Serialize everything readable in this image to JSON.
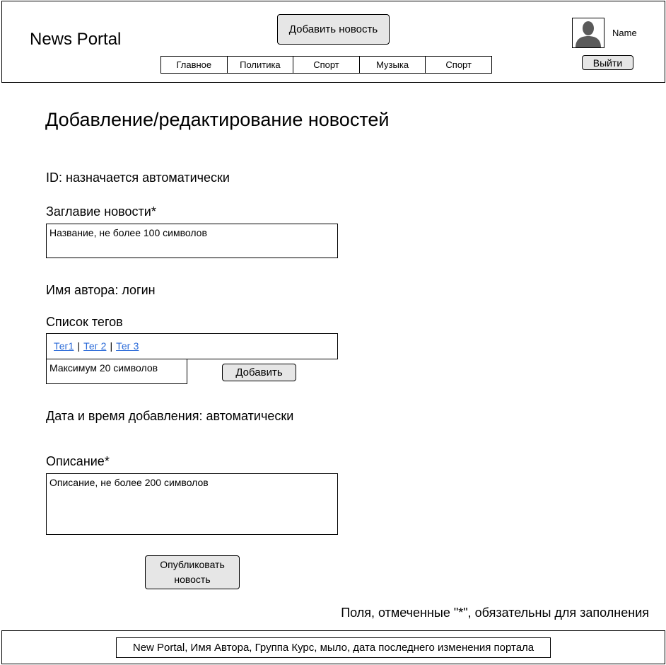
{
  "header": {
    "logo": "News Portal",
    "add_news_label": "Добавить новость",
    "nav": [
      "Главное",
      "Политика",
      "Спорт",
      "Музыка",
      "Спорт"
    ],
    "user_name": "Name",
    "logout_label": "Выйти",
    "avatar_icon": "user-avatar-icon"
  },
  "form": {
    "page_title": "Добавление/редактирование новостей",
    "id_label": "ID: назначается автоматически",
    "title_label": "Заглавие новости*",
    "title_placeholder": "Название, не более 100 символов",
    "author_label": "Имя автора: логин",
    "tags_label": "Список тегов",
    "tags": [
      "Тег1",
      "Тег 2",
      "Тег 3"
    ],
    "tag_separator": "|",
    "tag_placeholder": "Максимум 20 символов",
    "tag_add_label": "Добавить",
    "date_label": "Дата и время добавления: автоматически",
    "description_label": "Описание*",
    "description_placeholder": "Описание, не более 200 символов",
    "publish_line1": "Опубликовать",
    "publish_line2": "новость",
    "required_note": "Поля, отмеченные \"*\", обязательны для заполнения"
  },
  "footer": {
    "text": "New Portal, Имя Автора, Группа Курс, мыло, дата последнего изменения портала"
  },
  "colors": {
    "button_bg": "#e6e6e6",
    "link": "#2a6ad8",
    "avatar": "#5a5a5a"
  }
}
